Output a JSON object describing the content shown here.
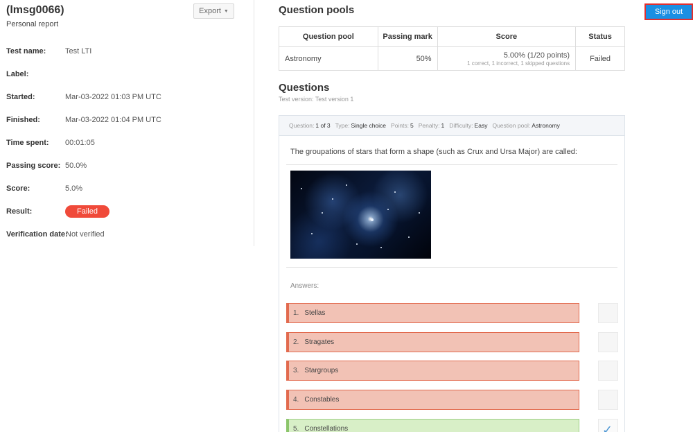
{
  "header": {
    "user_id": "(lmsg0066)",
    "subtitle": "Personal report",
    "export_label": "Export",
    "signout_label": "Sign out"
  },
  "info": [
    {
      "label": "Test name:",
      "value": "Test LTI"
    },
    {
      "label": "Label:",
      "value": ""
    },
    {
      "label": "Started:",
      "value": "Mar-03-2022 01:03 PM UTC"
    },
    {
      "label": "Finished:",
      "value": "Mar-03-2022 01:04 PM UTC"
    },
    {
      "label": "Time spent:",
      "value": "00:01:05"
    },
    {
      "label": "Passing score:",
      "value": "50.0%"
    },
    {
      "label": "Score:",
      "value": "5.0%"
    },
    {
      "label": "Result:",
      "value": "Failed"
    },
    {
      "label": "Verification date:",
      "value": "Not verified"
    }
  ],
  "pools": {
    "title": "Question pools",
    "columns": [
      "Question pool",
      "Passing mark",
      "Score",
      "Status"
    ],
    "rows": [
      {
        "pool": "Astronomy",
        "passing_mark": "50%",
        "score": "5.00% (1/20 points)",
        "score_detail": "1 correct, 1 incorrect, 1 skipped questions",
        "status": "Failed"
      }
    ]
  },
  "questions": {
    "title": "Questions",
    "version": "Test version: Test version 1",
    "meta": {
      "question_label": "Question:",
      "question_value": "1 of 3",
      "type_label": "Type:",
      "type_value": "Single choice",
      "points_label": "Points:",
      "points_value": "5",
      "penalty_label": "Penalty:",
      "penalty_value": "1",
      "difficulty_label": "Difficulty:",
      "difficulty_value": "Easy",
      "pool_label": "Question pool:",
      "pool_value": "Astronomy"
    },
    "text": "The groupations of stars that form a shape (such as Crux and Ursa Major) are called:",
    "answers_label": "Answers:",
    "answers": [
      {
        "num": "1.",
        "label": "Stellas",
        "state": "incorrect",
        "selected": false
      },
      {
        "num": "2.",
        "label": "Stragates",
        "state": "incorrect",
        "selected": false
      },
      {
        "num": "3.",
        "label": "Stargroups",
        "state": "incorrect",
        "selected": false
      },
      {
        "num": "4.",
        "label": "Constables",
        "state": "incorrect",
        "selected": false
      },
      {
        "num": "5.",
        "label": "Constellations",
        "state": "correct",
        "selected": true
      }
    ]
  },
  "colors": {
    "accent": "#1a8fe3",
    "failed": "#f04a3a",
    "incorrect_bg": "#f2c2b5",
    "correct_bg": "#d8efc7"
  },
  "icons": {
    "export_caret": "caret-down-icon",
    "selected_answer": "check-icon"
  }
}
